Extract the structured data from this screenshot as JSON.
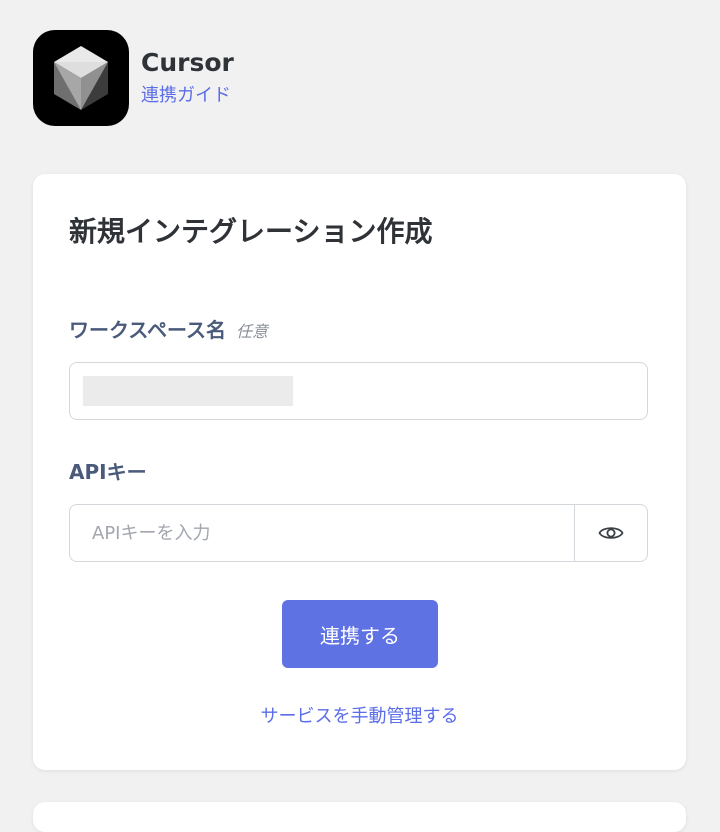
{
  "app": {
    "name": "Cursor",
    "guide_link": "連携ガイド",
    "logo_icon": "cursor-logo-icon"
  },
  "form": {
    "title": "新規インテグレーション作成",
    "workspace": {
      "label": "ワークスペース名",
      "optional": "任意",
      "value": ""
    },
    "api_key": {
      "label": "APIキー",
      "placeholder": "APIキーを入力",
      "toggle_icon": "eye-icon"
    },
    "submit_label": "連携する",
    "manual_link": "サービスを手動管理する"
  },
  "colors": {
    "accent": "#5e72e4",
    "link": "#5b6ee8",
    "label": "#4a5a7a",
    "background": "#f1f1f1"
  }
}
